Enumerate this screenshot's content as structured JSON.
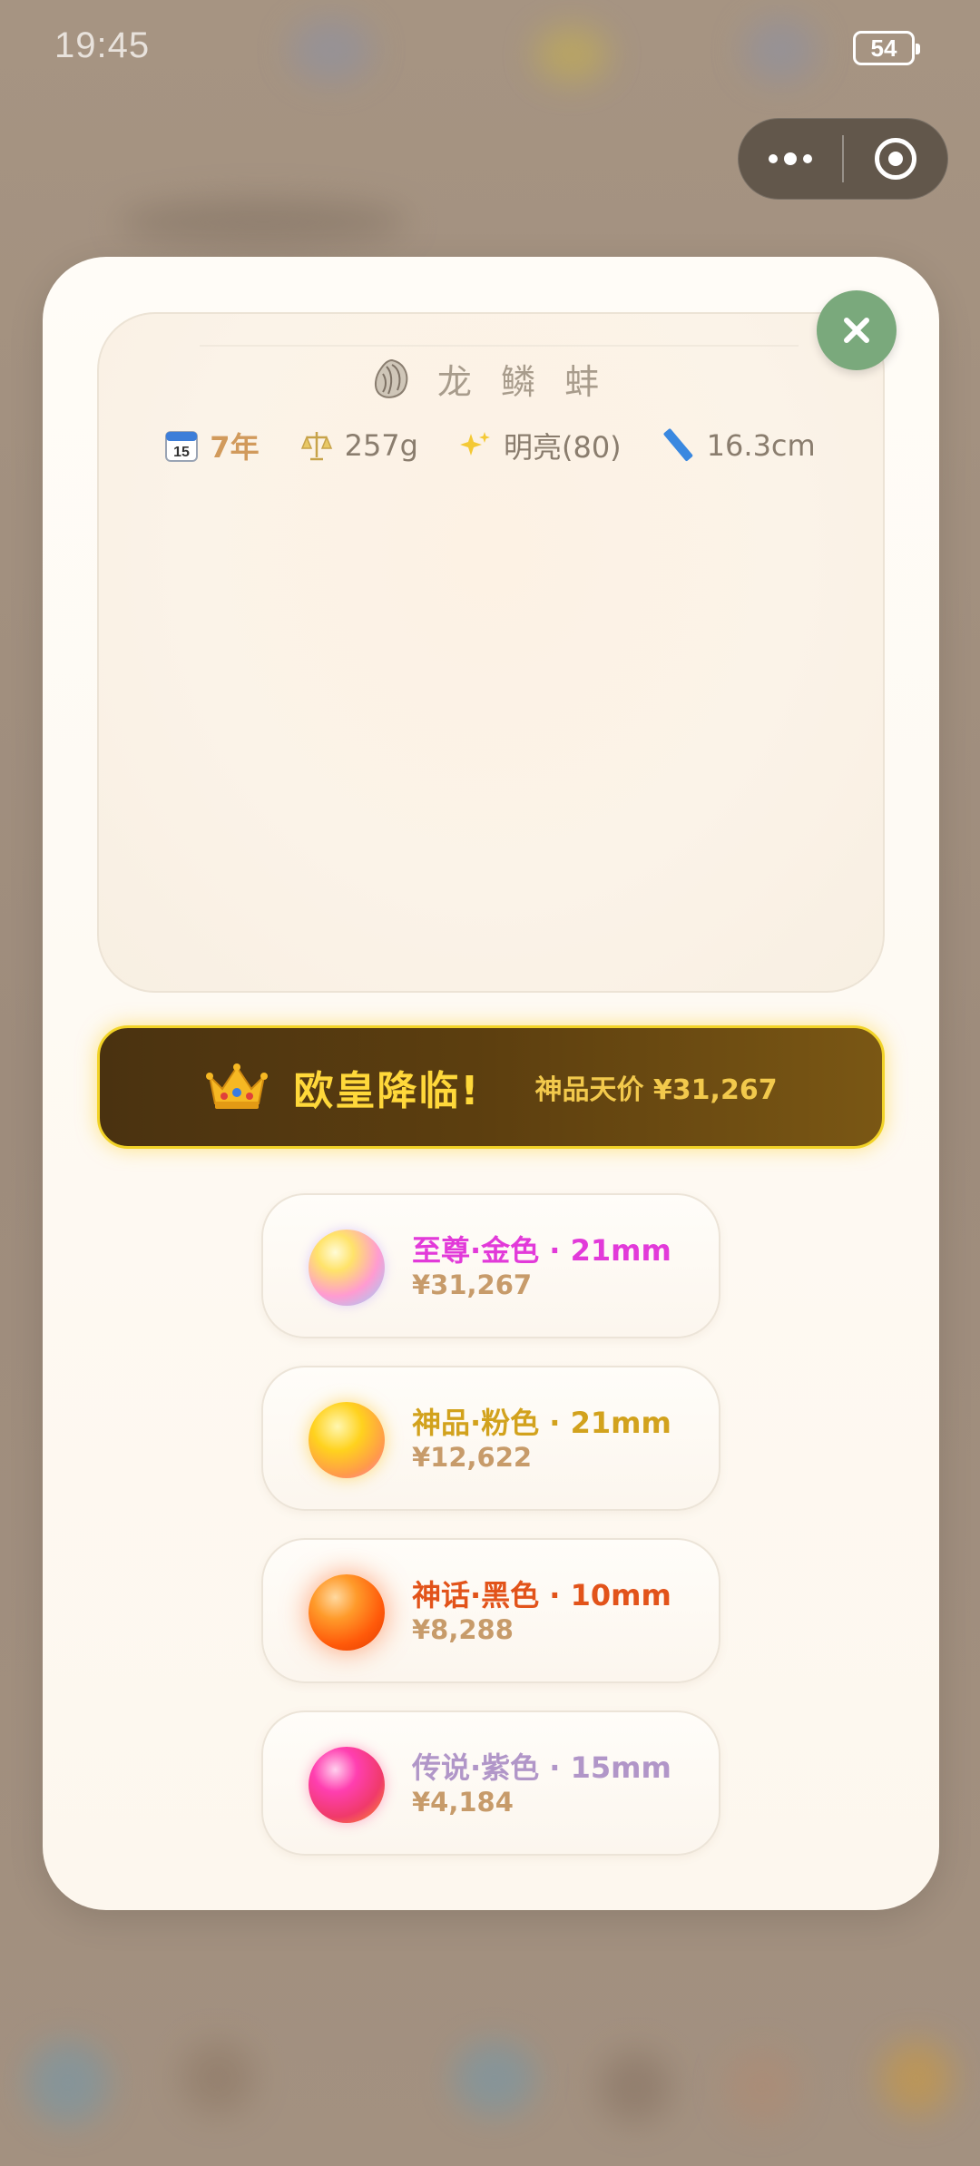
{
  "status_bar": {
    "time": "19:45",
    "battery": "54"
  },
  "modal": {
    "shell": {
      "icon": "oyster-icon",
      "name": "龙 鳞 蚌"
    },
    "stats": {
      "age": "7年",
      "weight": "257g",
      "luster": "明亮(80)",
      "length": "16.3cm"
    },
    "banner": {
      "icon": "crown-icon",
      "title": "欧皇降临!",
      "price_text": "神品天价 ¥31,267"
    },
    "pearls": [
      {
        "title": "至尊·金色 · 21mm",
        "price": "¥31,267",
        "title_color": "#e23ad9"
      },
      {
        "title": "神品·粉色 · 21mm",
        "price": "¥12,622",
        "title_color": "#d2a21d"
      },
      {
        "title": "神话·黑色 · 10mm",
        "price": "¥8,288",
        "title_color": "#e2531a"
      },
      {
        "title": "传说·紫色 · 15mm",
        "price": "¥4,184",
        "title_color": "#b196c8"
      }
    ]
  },
  "colors": {
    "close_button": "#7aa97c",
    "banner_border": "#f2d327",
    "banner_text": "#ffd83a"
  }
}
